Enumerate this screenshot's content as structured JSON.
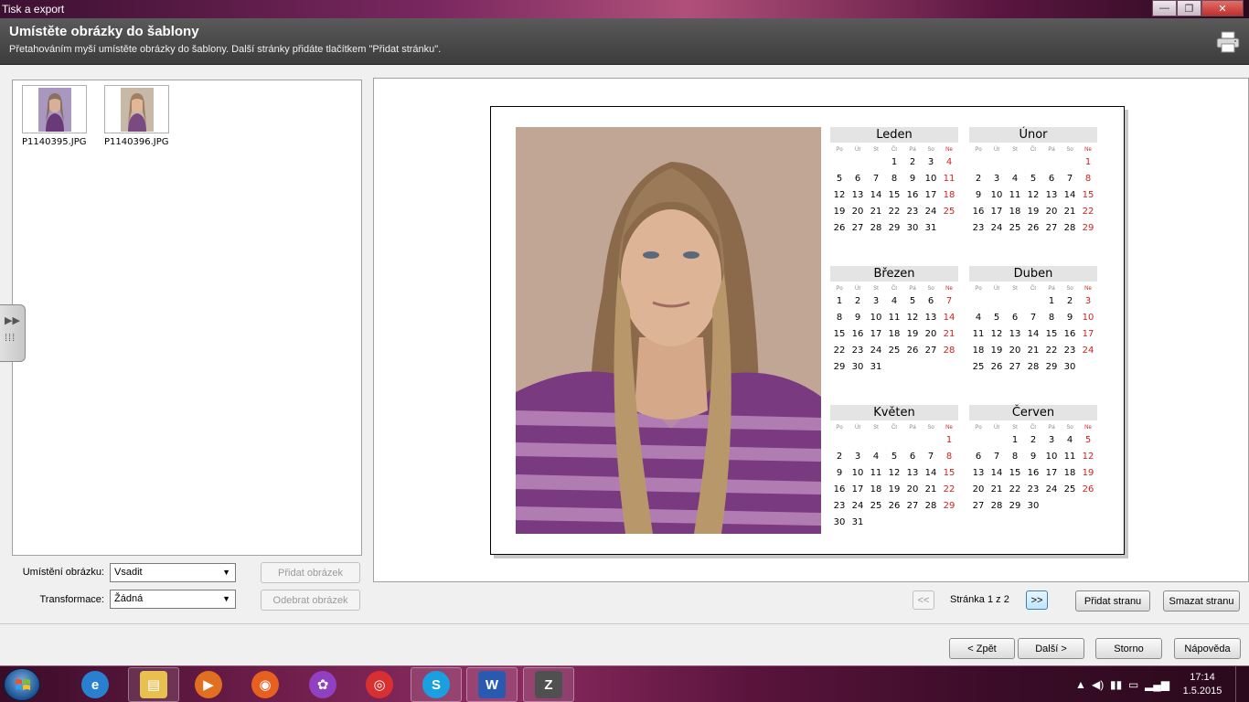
{
  "window": {
    "title": "Tisk a export",
    "minimize": "—",
    "maximize": "❐",
    "close": "✕"
  },
  "header": {
    "title": "Umístěte obrázky do šablony",
    "subtitle": "Přetahováním myší umístěte obrázky do šablony. Další stránky přidáte tlačítkem \"Přidat stránku\".",
    "icon": "printer-icon"
  },
  "images": [
    {
      "name": "P1140395.JPG"
    },
    {
      "name": "P1140396.JPG"
    }
  ],
  "controls": {
    "placement_label": "Umístění obrázku:",
    "placement_value": "Vsadit",
    "transform_label": "Transformace:",
    "transform_value": "Žádná",
    "add_image": "Přidat obrázek",
    "remove_image": "Odebrat obrázek"
  },
  "pager": {
    "prev": "<<",
    "next": ">>",
    "label": "Stránka 1 z 2",
    "add_page": "Přidat stranu",
    "delete_page": "Smazat stranu"
  },
  "calendar": {
    "day_headers": [
      "Po",
      "Út",
      "St",
      "Čt",
      "Pá",
      "So",
      "Ne"
    ],
    "months": [
      {
        "name": "Leden",
        "offset": 3,
        "days": 31
      },
      {
        "name": "Únor",
        "offset": 6,
        "days": 29
      },
      {
        "name": "Březen",
        "offset": 0,
        "days": 31
      },
      {
        "name": "Duben",
        "offset": 4,
        "days": 30
      },
      {
        "name": "Květen",
        "offset": 6,
        "days": 31
      },
      {
        "name": "Červen",
        "offset": 2,
        "days": 30
      }
    ]
  },
  "footer": {
    "back": "< Zpět",
    "next": "Další >",
    "cancel": "Storno",
    "help": "Nápověda"
  },
  "taskbar": {
    "items": [
      "internet-explorer-icon",
      "file-explorer-icon",
      "media-player-icon",
      "firefox-icon",
      "photo-gallery-icon",
      "chrome-icon",
      "skype-icon",
      "word-icon",
      "zoner-photo-icon"
    ],
    "time": "17:14",
    "date": "1.5.2015"
  }
}
